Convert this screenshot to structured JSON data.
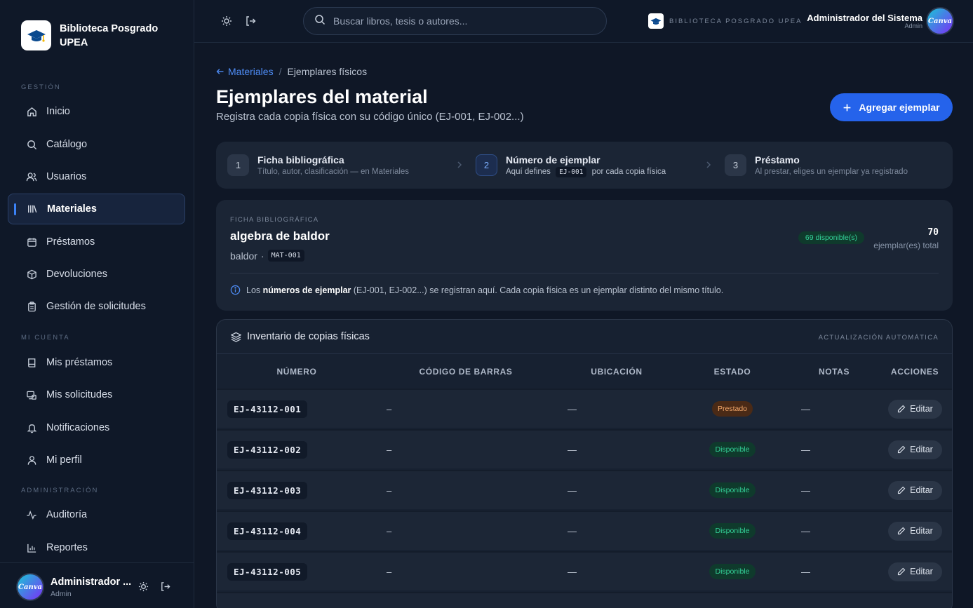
{
  "brand": {
    "name": "Biblioteca Posgrado UPEA"
  },
  "sidebar": {
    "sections": [
      "GESTIÓN",
      "MI CUENTA",
      "ADMINISTRACIÓN"
    ],
    "items": [
      {
        "label": "Inicio",
        "icon": "home-icon"
      },
      {
        "label": "Catálogo",
        "icon": "search-icon"
      },
      {
        "label": "Usuarios",
        "icon": "users-icon"
      },
      {
        "label": "Materiales",
        "icon": "library-icon",
        "active": true
      },
      {
        "label": "Préstamos",
        "icon": "calendar-icon"
      },
      {
        "label": "Devoluciones",
        "icon": "package-icon"
      },
      {
        "label": "Gestión de solicitudes",
        "icon": "clipboard-icon"
      },
      {
        "label": "Mis préstamos",
        "icon": "book-icon"
      },
      {
        "label": "Mis solicitudes",
        "icon": "request-icon"
      },
      {
        "label": "Notificaciones",
        "icon": "bell-icon"
      },
      {
        "label": "Mi perfil",
        "icon": "user-icon"
      },
      {
        "label": "Auditoría",
        "icon": "activity-icon"
      },
      {
        "label": "Reportes",
        "icon": "bar-chart-icon"
      }
    ],
    "footer": {
      "user_name": "Administrador ...",
      "role": "Admin",
      "avatar_text": "Canva"
    }
  },
  "topbar": {
    "search_placeholder": "Buscar libros, tesis o autores...",
    "brand_label": "BIBLIOTECA POSGRADO UPEA",
    "user_name": "Administrador del Sistema",
    "user_role": "Admin",
    "avatar_text": "Canva"
  },
  "breadcrumb": {
    "back": "Materiales",
    "separator": "/",
    "current": "Ejemplares físicos"
  },
  "page": {
    "title": "Ejemplares del material",
    "subtitle": "Registra cada copia física con su código único (EJ-001, EJ-002...)",
    "add_button": "Agregar ejemplar"
  },
  "steps": [
    {
      "num": "1",
      "title": "Ficha bibliográfica",
      "desc": "Título, autor, clasificación — en Materiales"
    },
    {
      "num": "2",
      "title": "Número de ejemplar",
      "desc_before": "Aquí defines",
      "desc_code": "EJ-001",
      "desc_after": "por cada copia física",
      "active": true
    },
    {
      "num": "3",
      "title": "Préstamo",
      "desc": "Al prestar, eliges un ejemplar ya registrado"
    }
  ],
  "ficha": {
    "label": "FICHA BIBLIOGRÁFICA",
    "title": "algebra de baldor",
    "author": "baldor",
    "separator": "·",
    "code": "MAT-001",
    "available_badge": "69 disponible(s)",
    "total": "70",
    "total_label": "ejemplar(es) total",
    "info_before": "Los",
    "info_bold": "números de ejemplar",
    "info_after": "(EJ-001, EJ-002...) se registran aquí. Cada copia física es un ejemplar distinto del mismo título."
  },
  "inventory": {
    "title": "Inventario de copias físicas",
    "auto_label": "ACTUALIZACIÓN AUTOMÁTICA",
    "columns": [
      "NÚMERO",
      "CÓDIGO DE BARRAS",
      "UBICACIÓN",
      "ESTADO",
      "NOTAS",
      "ACCIONES"
    ],
    "edit_label": "Editar",
    "rows": [
      {
        "numero": "EJ-43112-001",
        "barcode": "–",
        "ubicacion": "—",
        "estado": "Prestado",
        "notas": "—"
      },
      {
        "numero": "EJ-43112-002",
        "barcode": "–",
        "ubicacion": "—",
        "estado": "Disponible",
        "notas": "—"
      },
      {
        "numero": "EJ-43112-003",
        "barcode": "–",
        "ubicacion": "—",
        "estado": "Disponible",
        "notas": "—"
      },
      {
        "numero": "EJ-43112-004",
        "barcode": "–",
        "ubicacion": "—",
        "estado": "Disponible",
        "notas": "—"
      },
      {
        "numero": "EJ-43112-005",
        "barcode": "–",
        "ubicacion": "—",
        "estado": "Disponible",
        "notas": "—"
      }
    ]
  },
  "colors": {
    "accent": "#2563eb",
    "available_text": "#34d399",
    "available_bg": "#0f3a2c",
    "borrowed_text": "#f4a86a",
    "borrowed_bg": "#4a2a16"
  }
}
